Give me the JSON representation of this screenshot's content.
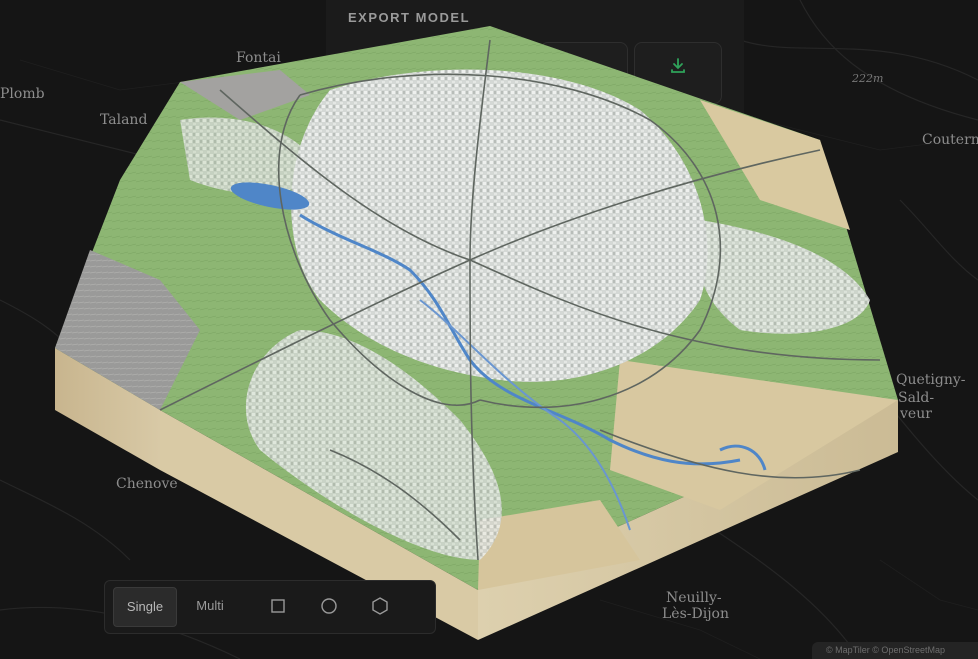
{
  "export": {
    "title": "EXPORT MODEL"
  },
  "map": {
    "places": [
      {
        "id": "fontaine",
        "label": "Fontai"
      },
      {
        "id": "plombieres",
        "label": "Plomb"
      },
      {
        "id": "talant",
        "label": "Taland"
      },
      {
        "id": "chenove",
        "label": "Chenove"
      },
      {
        "id": "couternon",
        "label": "Coutern"
      },
      {
        "id": "quetigny",
        "label": "Quetigny-"
      },
      {
        "id": "quetigny2",
        "label": "Sald-"
      },
      {
        "id": "quetigny3",
        "label": "veur"
      },
      {
        "id": "neuilly",
        "label": "Neuilly-"
      },
      {
        "id": "neuilly2",
        "label": "Lès-Dijon"
      },
      {
        "id": "elev",
        "label": "222m"
      }
    ],
    "colors": {
      "background": "#151515",
      "parkland": "#8fb674",
      "urban": "#cfd3d1",
      "rock": "#9c9c9c",
      "water": "#4f86c8",
      "base": "#d6c7a4",
      "farmland": "#d9c9a0"
    }
  },
  "toolbar": {
    "single_label": "Single",
    "multi_label": "Multi",
    "square_icon": "square-icon",
    "circle_icon": "circle-icon",
    "hexagon_icon": "hexagon-icon"
  },
  "attribution": {
    "text": "© MapTiler © OpenStreetMap"
  }
}
